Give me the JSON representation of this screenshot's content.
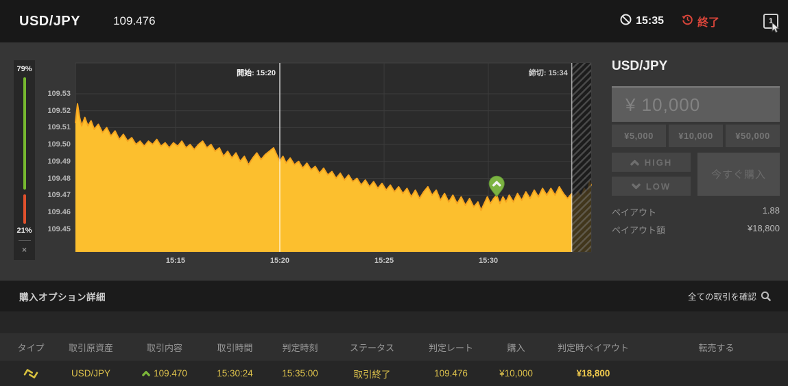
{
  "header": {
    "symbol": "USD/JPY",
    "price": "109.476",
    "cutoff_time": "15:35",
    "end_label": "終了",
    "window_badge": "1"
  },
  "gauge": {
    "high_pct": "79%",
    "low_pct": "21%",
    "close_label": "×",
    "high_color": "#76b82f",
    "low_color": "#e0512d"
  },
  "trade_panel": {
    "title": "USD/JPY",
    "amount_value": "¥ 10,000",
    "presets": [
      "¥5,000",
      "¥10,000",
      "¥50,000"
    ],
    "high_label": "HIGH",
    "low_label": "LOW",
    "buy_label": "今すぐ購入",
    "payout_label": "ペイアウト",
    "payout_value": "1.88",
    "payout_amount_label": "ペイアウト額",
    "payout_amount_value": "¥18,800"
  },
  "history": {
    "section_title": "購入オプション詳細",
    "view_all_label": "全ての取引を確認",
    "columns": [
      "タイプ",
      "取引原資産",
      "取引内容",
      "取引時間",
      "判定時刻",
      "ステータス",
      "判定レート",
      "購入",
      "判定時ペイアウト",
      "転売する"
    ],
    "row": {
      "type_icon": "turbo-trade-icon",
      "asset": "USD/JPY",
      "direction": "high",
      "contents": "109.470",
      "trade_time": "15:30:24",
      "decision_time": "15:35:00",
      "status": "取引終了",
      "decision_rate": "109.476",
      "purchase": "¥10,000",
      "payout": "¥18,800",
      "resell": ""
    }
  },
  "icons": {
    "no-entry-icon": "prohibition circle-slash",
    "history-icon": "red circular arrow clock",
    "window-count-icon": "square with count 1",
    "search-icon": "magnifier",
    "high-icon": "chevron-up",
    "low-icon": "chevron-down",
    "pin-icon": "green map pin with chevron-up"
  },
  "chart_data": {
    "type": "area",
    "title": "USD/JPY tick chart",
    "series_name": "USD/JPY",
    "fill_color": "#fcbf2e",
    "stroke_color": "#f6a51f",
    "plot_bg": "#2b2b2b",
    "grid_color": "#3c3c3c",
    "x_axis": {
      "tick_labels": [
        "15:15",
        "15:20",
        "15:25",
        "15:30"
      ],
      "tick_minutes": [
        5,
        10,
        15,
        20
      ],
      "minutes_origin": "15:10",
      "domain_minutes": [
        0.2,
        24.93
      ]
    },
    "y_axis": {
      "tick_labels": [
        "109.53",
        "109.52",
        "109.51",
        "109.50",
        "109.49",
        "109.48",
        "109.47",
        "109.46",
        "109.45"
      ],
      "ticks": [
        109.53,
        109.52,
        109.51,
        109.5,
        109.49,
        109.48,
        109.47,
        109.46,
        109.45
      ],
      "range": [
        109.4365,
        109.548
      ]
    },
    "open_marker": {
      "label": "開始: 15:20",
      "minute": 10
    },
    "close_marker": {
      "label": "締切: 15:34",
      "minute": 24
    },
    "expiry_hatch_minutes": [
      24,
      24.93
    ],
    "purchase_pin": {
      "minute": 20.4,
      "price": 109.47,
      "direction": "high",
      "color": "#7cb342"
    },
    "points": [
      [
        0.2,
        109.513
      ],
      [
        0.3,
        109.524
      ],
      [
        0.4,
        109.516
      ],
      [
        0.5,
        109.511
      ],
      [
        0.65,
        109.516
      ],
      [
        0.8,
        109.511
      ],
      [
        0.95,
        109.514
      ],
      [
        1.1,
        109.509
      ],
      [
        1.3,
        109.512
      ],
      [
        1.5,
        109.507
      ],
      [
        1.7,
        109.51
      ],
      [
        1.9,
        109.505
      ],
      [
        2.1,
        109.508
      ],
      [
        2.3,
        109.503
      ],
      [
        2.5,
        109.506
      ],
      [
        2.7,
        109.502
      ],
      [
        2.9,
        109.504
      ],
      [
        3.1,
        109.5
      ],
      [
        3.3,
        109.502
      ],
      [
        3.5,
        109.499
      ],
      [
        3.7,
        109.502
      ],
      [
        3.9,
        109.5
      ],
      [
        4.1,
        109.503
      ],
      [
        4.3,
        109.499
      ],
      [
        4.5,
        109.501
      ],
      [
        4.7,
        109.498
      ],
      [
        4.9,
        109.501
      ],
      [
        5.1,
        109.499
      ],
      [
        5.3,
        109.502
      ],
      [
        5.5,
        109.498
      ],
      [
        5.7,
        109.5
      ],
      [
        5.9,
        109.497
      ],
      [
        6.1,
        109.5
      ],
      [
        6.3,
        109.502
      ],
      [
        6.5,
        109.498
      ],
      [
        6.7,
        109.5
      ],
      [
        6.9,
        109.496
      ],
      [
        7.1,
        109.498
      ],
      [
        7.3,
        109.493
      ],
      [
        7.5,
        109.496
      ],
      [
        7.7,
        109.492
      ],
      [
        7.9,
        109.495
      ],
      [
        8.1,
        109.49
      ],
      [
        8.3,
        109.493
      ],
      [
        8.5,
        109.488
      ],
      [
        8.7,
        109.492
      ],
      [
        8.9,
        109.495
      ],
      [
        9.1,
        109.491
      ],
      [
        9.3,
        109.494
      ],
      [
        9.5,
        109.496
      ],
      [
        9.7,
        109.498
      ],
      [
        9.85,
        109.494
      ],
      [
        10.0,
        109.49
      ],
      [
        10.15,
        109.493
      ],
      [
        10.3,
        109.489
      ],
      [
        10.5,
        109.492
      ],
      [
        10.7,
        109.488
      ],
      [
        10.9,
        109.49
      ],
      [
        11.1,
        109.486
      ],
      [
        11.3,
        109.489
      ],
      [
        11.5,
        109.485
      ],
      [
        11.7,
        109.487
      ],
      [
        11.9,
        109.483
      ],
      [
        12.1,
        109.486
      ],
      [
        12.3,
        109.482
      ],
      [
        12.5,
        109.484
      ],
      [
        12.7,
        109.48
      ],
      [
        12.9,
        109.483
      ],
      [
        13.1,
        109.479
      ],
      [
        13.3,
        109.482
      ],
      [
        13.5,
        109.478
      ],
      [
        13.7,
        109.48
      ],
      [
        13.9,
        109.476
      ],
      [
        14.1,
        109.479
      ],
      [
        14.3,
        109.475
      ],
      [
        14.5,
        109.478
      ],
      [
        14.7,
        109.474
      ],
      [
        14.9,
        109.477
      ],
      [
        15.1,
        109.473
      ],
      [
        15.3,
        109.476
      ],
      [
        15.5,
        109.472
      ],
      [
        15.7,
        109.475
      ],
      [
        15.9,
        109.471
      ],
      [
        16.1,
        109.474
      ],
      [
        16.3,
        109.469
      ],
      [
        16.5,
        109.473
      ],
      [
        16.7,
        109.468
      ],
      [
        16.9,
        109.472
      ],
      [
        17.1,
        109.475
      ],
      [
        17.3,
        109.47
      ],
      [
        17.5,
        109.473
      ],
      [
        17.7,
        109.467
      ],
      [
        17.9,
        109.471
      ],
      [
        18.1,
        109.466
      ],
      [
        18.3,
        109.47
      ],
      [
        18.5,
        109.465
      ],
      [
        18.7,
        109.469
      ],
      [
        18.9,
        109.464
      ],
      [
        19.1,
        109.468
      ],
      [
        19.3,
        109.463
      ],
      [
        19.5,
        109.466
      ],
      [
        19.65,
        109.461
      ],
      [
        19.8,
        109.465
      ],
      [
        19.95,
        109.469
      ],
      [
        20.1,
        109.465
      ],
      [
        20.25,
        109.468
      ],
      [
        20.4,
        109.47
      ],
      [
        20.55,
        109.465
      ],
      [
        20.7,
        109.469
      ],
      [
        20.85,
        109.466
      ],
      [
        21.0,
        109.47
      ],
      [
        21.2,
        109.466
      ],
      [
        21.4,
        109.471
      ],
      [
        21.6,
        109.467
      ],
      [
        21.8,
        109.472
      ],
      [
        22.0,
        109.468
      ],
      [
        22.2,
        109.473
      ],
      [
        22.4,
        109.469
      ],
      [
        22.6,
        109.474
      ],
      [
        22.8,
        109.47
      ],
      [
        23.0,
        109.474
      ],
      [
        23.2,
        109.47
      ],
      [
        23.4,
        109.475
      ],
      [
        23.6,
        109.471
      ],
      [
        23.8,
        109.468
      ],
      [
        24.0,
        109.471
      ],
      [
        24.15,
        109.468
      ],
      [
        24.3,
        109.472
      ],
      [
        24.45,
        109.469
      ],
      [
        24.6,
        109.474
      ],
      [
        24.75,
        109.471
      ],
      [
        24.85,
        109.478
      ],
      [
        24.93,
        109.476
      ]
    ]
  }
}
